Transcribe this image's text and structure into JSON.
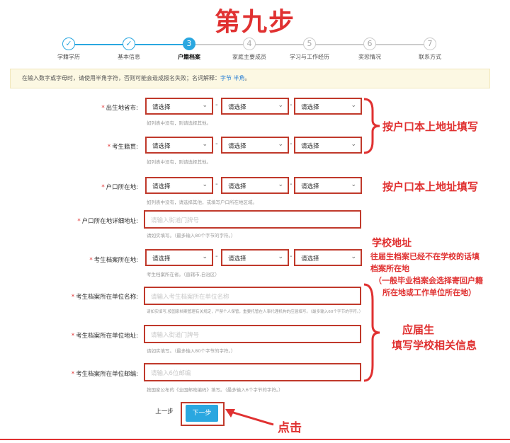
{
  "heading": "第九步",
  "steps": [
    {
      "label": "学籍学历",
      "mark": "✓"
    },
    {
      "label": "基本信息",
      "mark": "✓"
    },
    {
      "label": "户籍档案",
      "mark": "3"
    },
    {
      "label": "家庭主要成员",
      "mark": "4"
    },
    {
      "label": "学习与工作经历",
      "mark": "5"
    },
    {
      "label": "奖惩情况",
      "mark": "6"
    },
    {
      "label": "联系方式",
      "mark": "7"
    }
  ],
  "notice": {
    "text": "在输入数字或字母时，请使用半角字符，否则可能会造成报名失败；名词解释：",
    "link1": "字节",
    "link2": "半角",
    "end": "。"
  },
  "form": {
    "select_placeholder": "请选择",
    "birthplace": {
      "label": "出生地省市:",
      "hint": "如列表中没有，则请选择其他。"
    },
    "native_place": {
      "label": "考生籍贯:",
      "hint": "如列表中没有，则请选择其他。"
    },
    "hukou": {
      "label": "户口所在地:",
      "hint": "如列表中没有，请选择其他，或填写户口所在地区域。"
    },
    "hukou_detail": {
      "label": "户口所在地详细地址:",
      "placeholder": "请输入街道门牌号",
      "hint": "请如实填写。（最多输入80个字节的字符。）"
    },
    "archive_loc": {
      "label": "考生档案所在地:",
      "hint": "考生档案所在省。（直辖市,自治区）"
    },
    "archive_unit_name": {
      "label": "考生档案所在单位名称:",
      "placeholder": "请输入考生档案所在单位名称",
      "hint": "请如实填写,按国家档案管理有关规定，严禁个人保管，重要托管在人事代理机构的应届填写。（最多输入60个字节的字符。）"
    },
    "archive_unit_addr": {
      "label": "考生档案所在单位地址:",
      "placeholder": "请输入街道门牌号",
      "hint": "请如实填写。（最多输入80个字节的字符。）"
    },
    "archive_unit_zip": {
      "label": "考生档案所在单位邮编:",
      "placeholder": "请输入6位邮编",
      "hint": "按国家公布的《全国邮政编码》填写。（最多输入6个字节的字符。）"
    }
  },
  "buttons": {
    "prev": "上一步",
    "next": "下一步"
  },
  "annotations": {
    "a1": "按户口本上地址填写",
    "a2": "按户口本上地址填写",
    "a3_line1": "学校地址",
    "a3_line2": "往届生档案已经不在学校的话填",
    "a3_line3": "档案所在地",
    "a3_line4": "（一般毕业档案会选择寄回户籍",
    "a3_line5": "所在地或工作单位所在地）",
    "a4_line1": "应届生",
    "a4_line2": "填写学校相关信息",
    "a5": "点击"
  },
  "colors": {
    "accent": "#2aa7e0",
    "annotation": "#e03131",
    "highlight_box": "#c0392b"
  }
}
